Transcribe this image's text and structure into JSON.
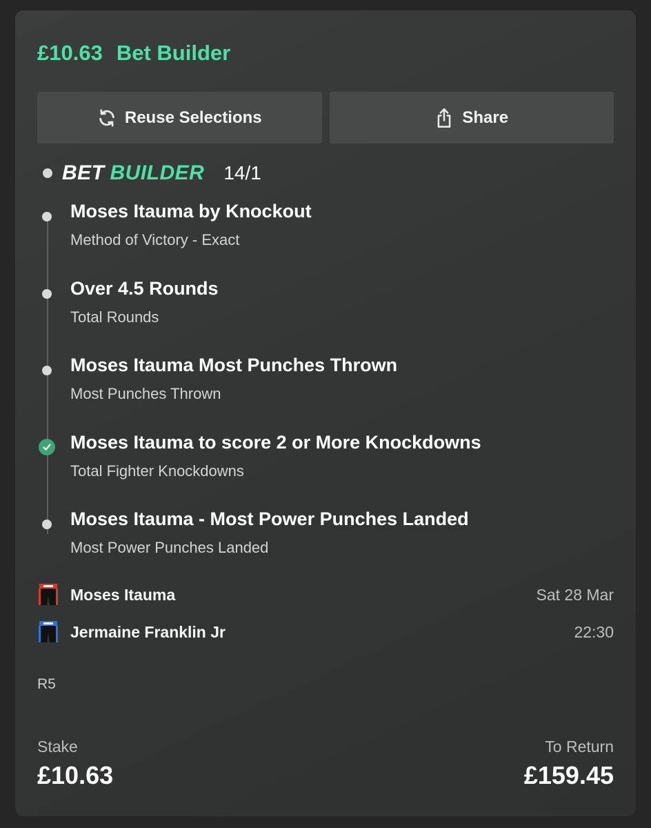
{
  "header": {
    "stake": "£10.63",
    "title": "Bet Builder"
  },
  "buttons": {
    "reuse": "Reuse Selections",
    "share": "Share"
  },
  "bet_builder": {
    "word1": "BET",
    "word2": "BUILDER",
    "odds": "14/1"
  },
  "selections": [
    {
      "title": "Moses Itauma by Knockout",
      "market": "Method of Victory - Exact",
      "status": "pending"
    },
    {
      "title": "Over 4.5 Rounds",
      "market": "Total Rounds",
      "status": "pending"
    },
    {
      "title": "Moses Itauma Most Punches Thrown",
      "market": "Most Punches Thrown",
      "status": "pending"
    },
    {
      "title": "Moses Itauma to score 2 or More Knockdowns",
      "market": "Total Fighter Knockdowns",
      "status": "won"
    },
    {
      "title": "Moses Itauma - Most Power Punches Landed",
      "market": "Most Power Punches Landed",
      "status": "pending"
    }
  ],
  "event": {
    "fighter1": {
      "name": "Moses Itauma",
      "color": "#d33a2c"
    },
    "fighter2": {
      "name": "Jermaine Franklin Jr",
      "color": "#2f74d0"
    },
    "date": "Sat 28 Mar",
    "time": "22:30",
    "round": "R5"
  },
  "footer": {
    "stake_label": "Stake",
    "stake_value": "£10.63",
    "return_label": "To Return",
    "return_value": "£159.45"
  },
  "colors": {
    "accent": "#4fe0a6",
    "won": "#3da47a"
  }
}
